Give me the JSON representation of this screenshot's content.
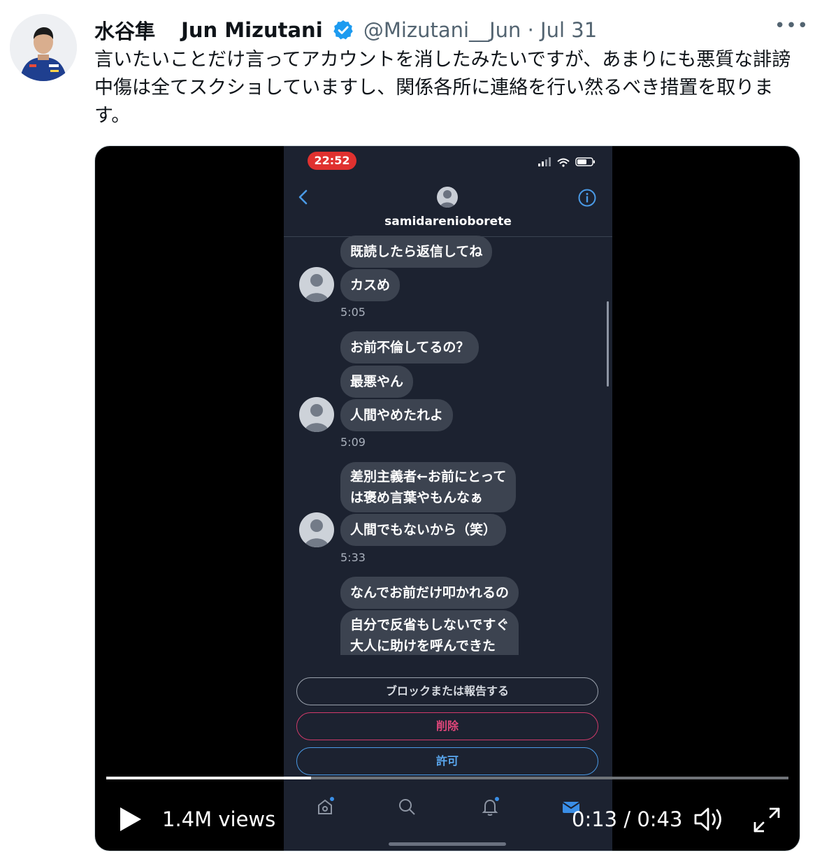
{
  "tweet": {
    "display_name_jp": "水谷隼",
    "display_name_en": "Jun Mizutani",
    "handle_date": "@Mizutani__Jun · Jul 31",
    "text": "言いたいことだけ言ってアカウントを消したみたいですが、あまりにも悪質な誹謗中傷は全てスクショしていますし、関係各所に連絡を行い然るべき措置を取ります。",
    "more_label": "•••"
  },
  "phone": {
    "clock": "22:52",
    "contact_name": "samidarenioborete",
    "messages": [
      "既読したら返信してね",
      "カスめ",
      "お前不倫してるの？",
      "最悪やん",
      "人間やめたれよ",
      "差別主義者←お前にとって",
      "は褒め言葉やもんなぁ",
      "人間でもないから（笑）",
      "なんでお前だけ叩かれるの",
      "自分で反省もしないですぐ",
      "大人に助けを呼んできた"
    ],
    "times": [
      "5:05",
      "5:09",
      "5:33"
    ],
    "buttons": {
      "block": "ブロックまたは報告する",
      "delete": "削除",
      "allow": "許可"
    },
    "colors": {
      "delete": "#e0467a",
      "allow": "#5aa8f0",
      "clock_pill": "#e0312f"
    }
  },
  "video": {
    "views": "1.4M views",
    "timecode": "0:13 / 0:43",
    "progress": 0.3
  }
}
